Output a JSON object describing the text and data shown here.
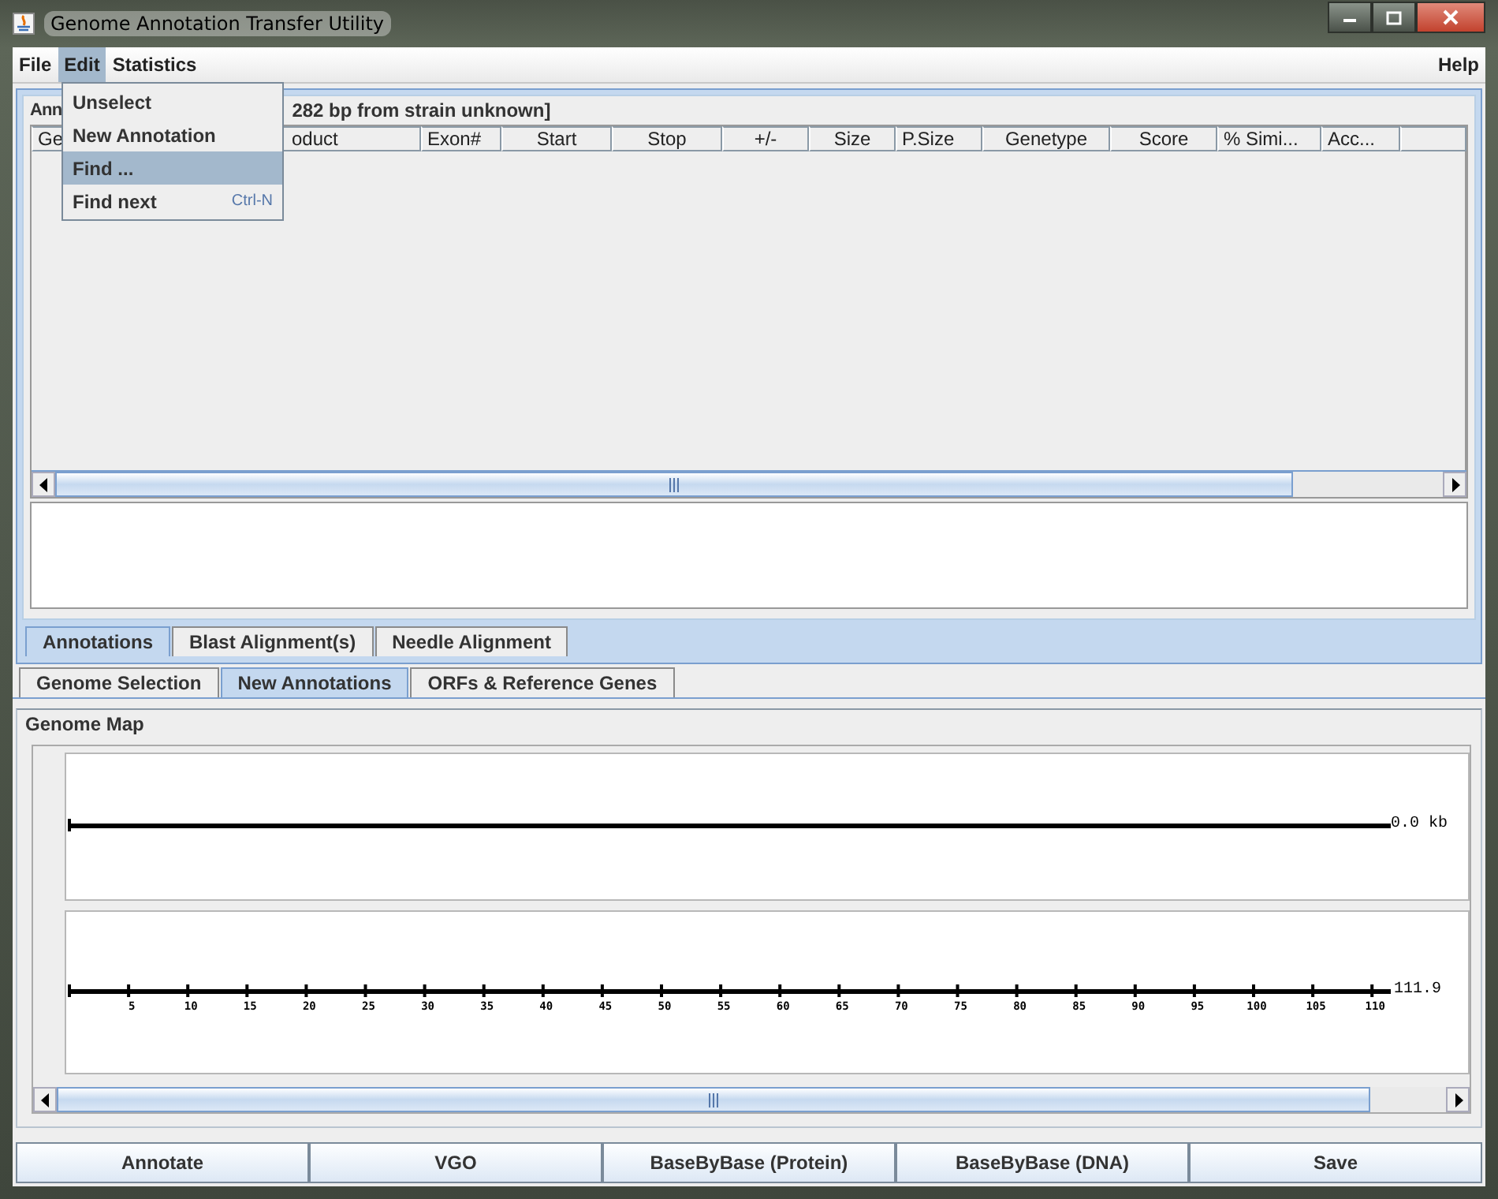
{
  "window": {
    "title": "Genome Annotation Transfer Utility"
  },
  "menu": [
    {
      "label": "File",
      "selected": false
    },
    {
      "label": "Edit",
      "selected": true
    },
    {
      "label": "Statistics",
      "selected": false
    }
  ],
  "help_menu": {
    "label": "Help"
  },
  "edit_menu": [
    {
      "label": "Unselect",
      "selected": false
    },
    {
      "label": "New Annotation",
      "selected": false
    },
    {
      "label": "Find ...",
      "selected": true
    },
    {
      "label": "Find next",
      "shortcut": "Ctrl-N",
      "selected": false
    }
  ],
  "annotation_panel": {
    "title_start": "Ann",
    "title_end": "282 bp from strain unknown]",
    "columns": [
      "Ge",
      "oduct",
      "Exon#",
      "Start",
      "Stop",
      "+/-",
      "Size",
      "P.Size",
      "Genetype",
      "Score",
      "% Simi...",
      "Acc..."
    ]
  },
  "inner_tabs": [
    {
      "label": "Annotations",
      "selected": true
    },
    {
      "label": "Blast Alignment(s)",
      "selected": false
    },
    {
      "label": "Needle Alignment",
      "selected": false
    }
  ],
  "outer_tabs": [
    {
      "label": "Genome Selection",
      "selected": false
    },
    {
      "label": "New Annotations",
      "selected": true
    },
    {
      "label": "ORFs & Reference Genes",
      "selected": false
    }
  ],
  "genome_map": {
    "title": "Genome Map",
    "top_track_label": "0.0 kb",
    "ruler_end_label": "111.9",
    "ruler_ticks": [
      "5",
      "10",
      "15",
      "20",
      "25",
      "30",
      "35",
      "40",
      "45",
      "50",
      "55",
      "60",
      "65",
      "70",
      "75",
      "80",
      "85",
      "90",
      "95",
      "100",
      "105",
      "110"
    ]
  },
  "buttons": [
    "Annotate",
    "VGO",
    "BaseByBase (Protein)",
    "BaseByBase (DNA)",
    "Save"
  ]
}
